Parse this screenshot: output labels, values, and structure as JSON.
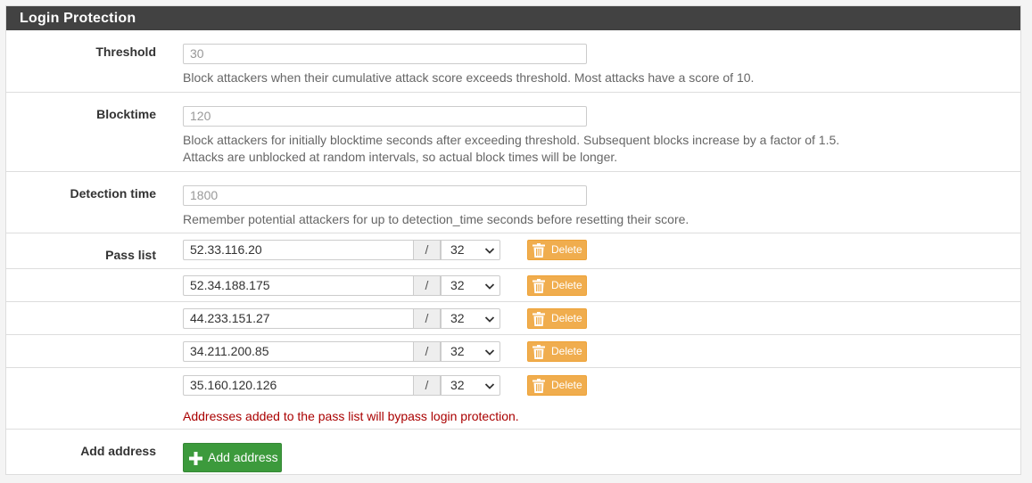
{
  "panel": {
    "title": "Login Protection"
  },
  "threshold": {
    "label": "Threshold",
    "placeholder": "30",
    "help": "Block attackers when their cumulative attack score exceeds threshold. Most attacks have a score of 10."
  },
  "blocktime": {
    "label": "Blocktime",
    "placeholder": "120",
    "help1": "Block attackers for initially blocktime seconds after exceeding threshold. Subsequent blocks increase by a factor of 1.5.",
    "help2": "Attacks are unblocked at random intervals, so actual block times will be longer."
  },
  "detection": {
    "label": "Detection time",
    "placeholder": "1800",
    "help": "Remember potential attackers for up to detection_time seconds before resetting their score."
  },
  "passlist": {
    "label": "Pass list",
    "slash": "/",
    "delete_label": "Delete",
    "entries": [
      {
        "address": "52.33.116.20",
        "mask": "32"
      },
      {
        "address": "52.34.188.175",
        "mask": "32"
      },
      {
        "address": "44.233.151.27",
        "mask": "32"
      },
      {
        "address": "34.211.200.85",
        "mask": "32"
      },
      {
        "address": "35.160.120.126",
        "mask": "32"
      }
    ],
    "help": "Addresses added to the pass list will bypass login protection."
  },
  "add": {
    "label": "Add address",
    "button_label": "Add address"
  },
  "colors": {
    "heading_bg": "#424242",
    "warning": "#f0ad4e",
    "success": "#3c9a3c",
    "help_red": "#aa0000"
  }
}
